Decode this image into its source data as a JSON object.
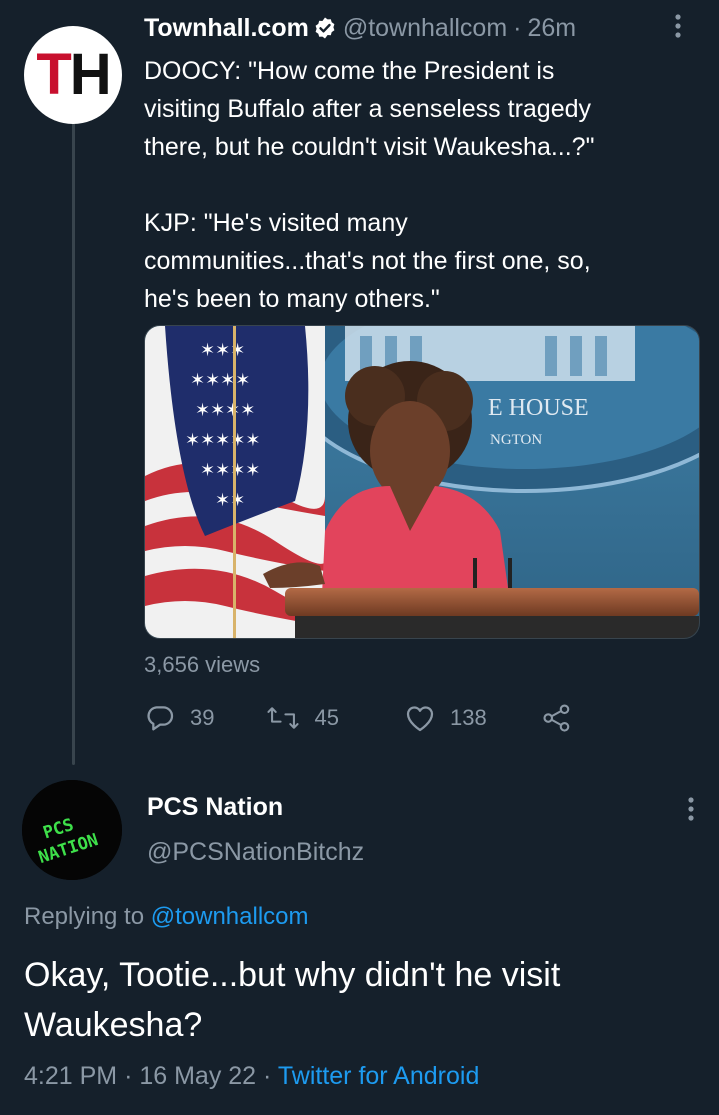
{
  "tweet": {
    "author": {
      "display_name": "Townhall.com",
      "handle": "@townhallcom",
      "verified": true,
      "avatar_text_t": "T",
      "avatar_text_h": "H"
    },
    "time_ago": "26m",
    "separator": "·",
    "text": "DOOCY: \"How come the President is\nvisiting Buffalo after a senseless tragedy\nthere, but he couldn't visit Waukesha...?\"\n\nKJP: \"He's visited many\ncommunities...that's not the first one, so,\nhe's been to many others.\"",
    "media": {
      "kind": "press briefing video still",
      "backdrop_text_1": "E HOUSE",
      "backdrop_text_2": "NGTON"
    },
    "views": "3,656 views",
    "stats": {
      "replies": "39",
      "retweets": "45",
      "likes": "138"
    }
  },
  "reply": {
    "author": {
      "display_name": "PCS Nation",
      "handle": "@PCSNationBitchz",
      "avatar_text_1": "PCS",
      "avatar_text_2": "NATION"
    },
    "replying_prefix": "Replying to",
    "replying_to": "@townhallcom",
    "text": "Okay, Tootie...but why didn't he visit Waukesha?",
    "time": "4:21 PM",
    "date": "16 May 22",
    "source": "Twitter for Android",
    "separator": "·"
  },
  "colors": {
    "background": "#15202b",
    "secondary_text": "#8b98a5",
    "link": "#1d9bf0",
    "thread_line": "#38444d"
  },
  "icons": [
    "verified-badge-icon",
    "more-options-icon",
    "reply-icon",
    "retweet-icon",
    "like-icon",
    "share-icon"
  ]
}
